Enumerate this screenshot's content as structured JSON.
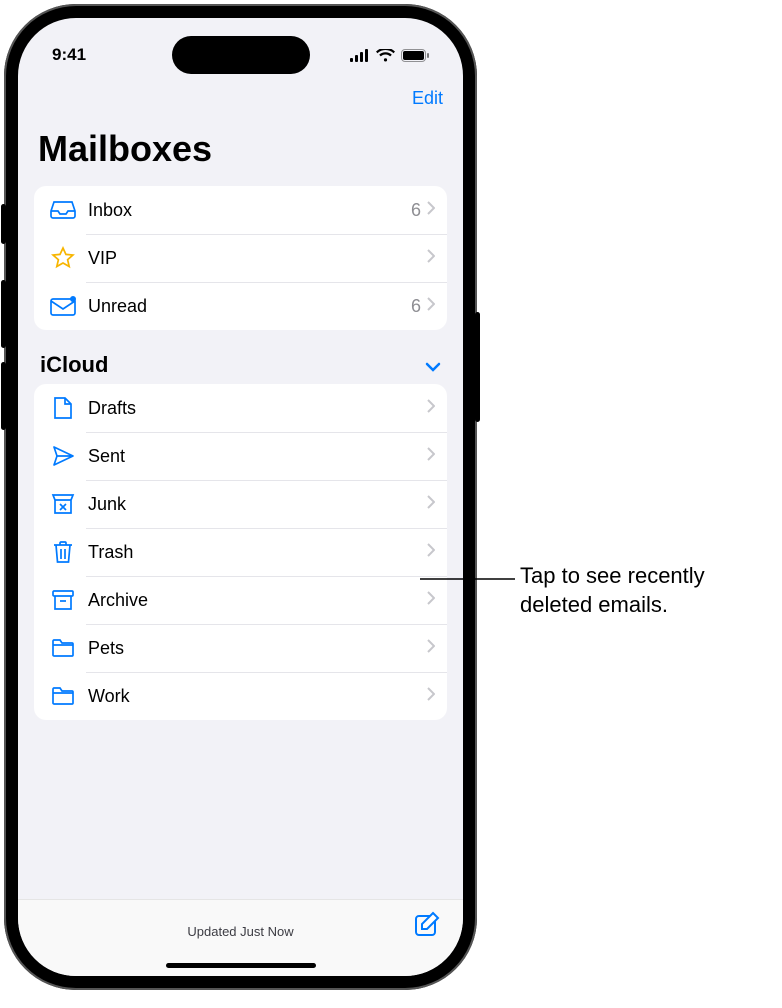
{
  "status": {
    "time": "9:41"
  },
  "toolbar": {
    "edit": "Edit"
  },
  "title": "Mailboxes",
  "favorites": [
    {
      "icon": "inbox-icon",
      "label": "Inbox",
      "count": "6"
    },
    {
      "icon": "vip-icon",
      "label": "VIP",
      "count": ""
    },
    {
      "icon": "unread-icon",
      "label": "Unread",
      "count": "6"
    }
  ],
  "section": {
    "title": "iCloud"
  },
  "icloud": [
    {
      "icon": "drafts-icon",
      "label": "Drafts"
    },
    {
      "icon": "sent-icon",
      "label": "Sent"
    },
    {
      "icon": "junk-icon",
      "label": "Junk"
    },
    {
      "icon": "trash-icon",
      "label": "Trash"
    },
    {
      "icon": "archive-icon",
      "label": "Archive"
    },
    {
      "icon": "folder-icon",
      "label": "Pets"
    },
    {
      "icon": "folder-icon",
      "label": "Work"
    }
  ],
  "bottom": {
    "status": "Updated Just Now"
  },
  "callout": {
    "text": "Tap to see recently deleted emails."
  }
}
